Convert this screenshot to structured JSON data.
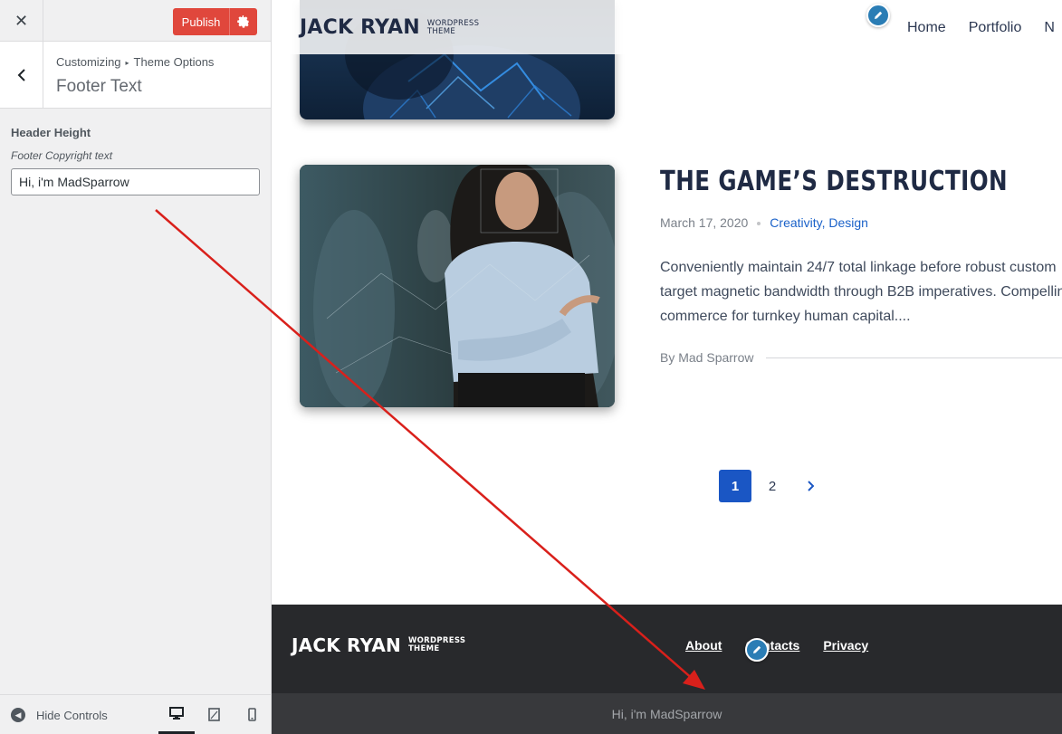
{
  "customizer": {
    "close_icon": "close-icon",
    "publish_label": "Publish",
    "breadcrumb_root": "Customizing",
    "breadcrumb_separator": "▸",
    "breadcrumb_parent": "Theme Options",
    "section_title": "Footer Text",
    "control_heading": "Header Height",
    "control_label": "Footer Copyright text",
    "control_value": "Hi, i'm MadSparrow",
    "hide_controls_label": "Hide Controls",
    "devices": [
      "desktop",
      "tablet",
      "mobile"
    ],
    "publish_color": "#e0473c"
  },
  "site": {
    "logo_main": "JACK RYAN",
    "logo_sub_line1": "WORDPRESS",
    "logo_sub_line2": "THEME",
    "nav": [
      "Home",
      "Portfolio",
      "N"
    ]
  },
  "post": {
    "title": "THE GAME’S DESTRUCTION",
    "date": "March 17, 2020",
    "categories": "Creativity, Design",
    "excerpt": "Conveniently maintain 24/7 total linkage before robust custom target magnetic bandwidth through B2B imperatives. Compelling commerce for turnkey human capital....",
    "author": "By Mad Sparrow"
  },
  "pagination": {
    "current": "1",
    "next_page": "2",
    "next_icon": "chevron-right-icon",
    "accent": "#1a56c4"
  },
  "footer": {
    "links": [
      "About",
      "Contacts",
      "Privacy"
    ],
    "copyright": "Hi, i'm MadSparrow",
    "background": "#28292c"
  },
  "annotation": {
    "arrow_color": "#d9201b"
  }
}
